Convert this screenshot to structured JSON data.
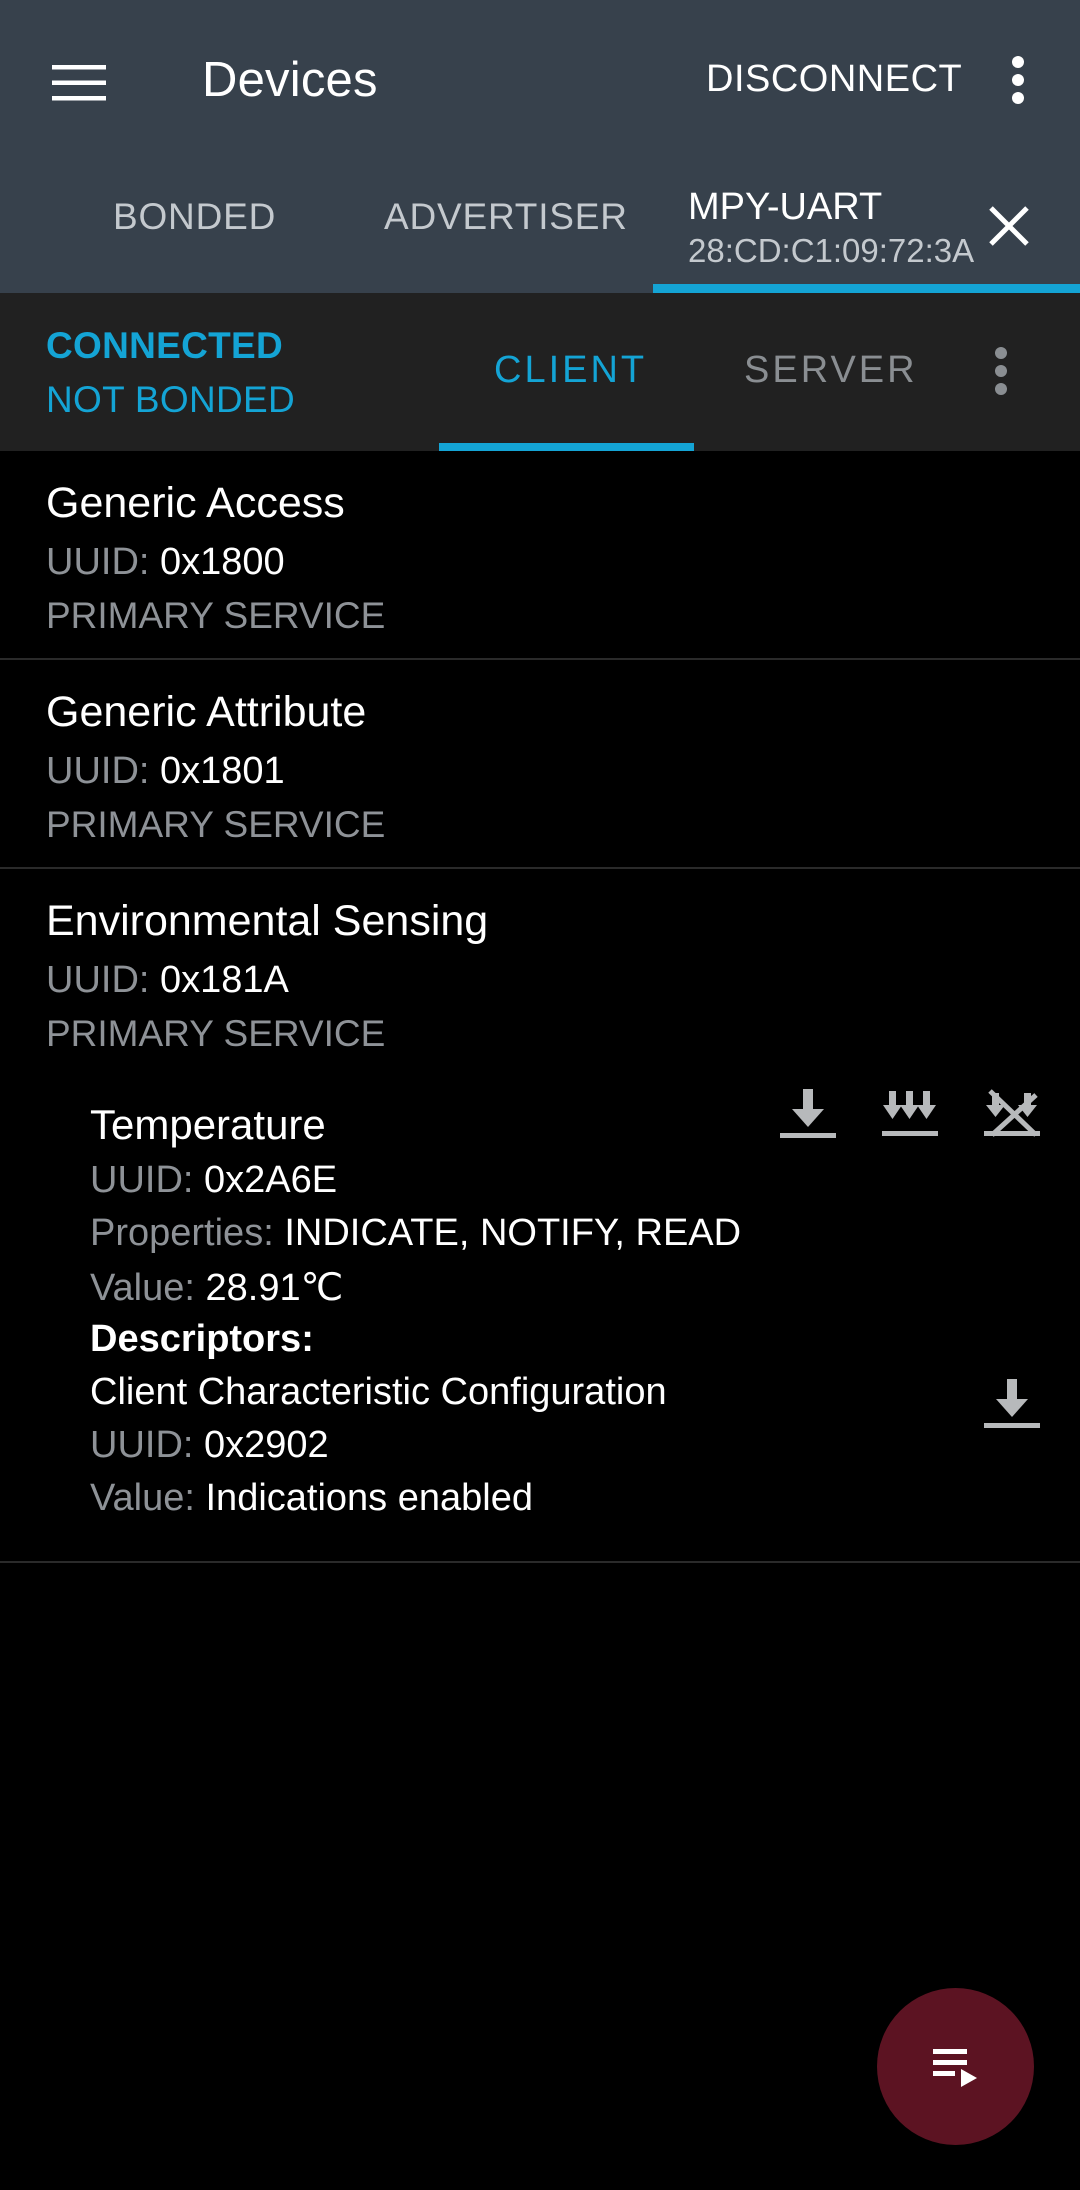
{
  "app_bar": {
    "title": "Devices",
    "disconnect_label": "DISCONNECT",
    "menu_icon": "hamburger-menu-icon",
    "overflow_icon": "more-vert-icon"
  },
  "device_tabs": {
    "bonded": "BONDED",
    "advertiser": "ADVERTISER",
    "active": {
      "name": "MPY-UART",
      "address": "28:CD:C1:09:72:3A",
      "close_icon": "close-icon"
    }
  },
  "connection": {
    "status": "CONNECTED",
    "bond_status": "NOT BONDED",
    "tabs": {
      "client": "CLIENT",
      "server": "SERVER"
    },
    "selected_tab": "CLIENT"
  },
  "labels": {
    "uuid": "UUID:",
    "properties": "Properties:",
    "value": "Value:",
    "descriptors": "Descriptors:"
  },
  "services": [
    {
      "name": "Generic Access",
      "uuid": "0x1800",
      "type": "PRIMARY SERVICE"
    },
    {
      "name": "Generic Attribute",
      "uuid": "0x1801",
      "type": "PRIMARY SERVICE"
    },
    {
      "name": "Environmental Sensing",
      "uuid": "0x181A",
      "type": "PRIMARY SERVICE",
      "characteristic": {
        "name": "Temperature",
        "uuid": "0x2A6E",
        "properties": "INDICATE, NOTIFY, READ",
        "value": "28.91℃",
        "actions": [
          "read-icon",
          "notify-icon",
          "indications-disabled-icon"
        ],
        "descriptor": {
          "name": "Client Characteristic Configuration",
          "uuid": "0x2902",
          "value": "Indications enabled",
          "action": "read-icon"
        }
      }
    }
  ],
  "fab_icon": "log-playlist-icon",
  "colors": {
    "app_bar": "#37414c",
    "accent": "#14a4d5",
    "connection_bar": "#212121",
    "fab": "#5c1322",
    "secondary_text": "#8e9297"
  }
}
